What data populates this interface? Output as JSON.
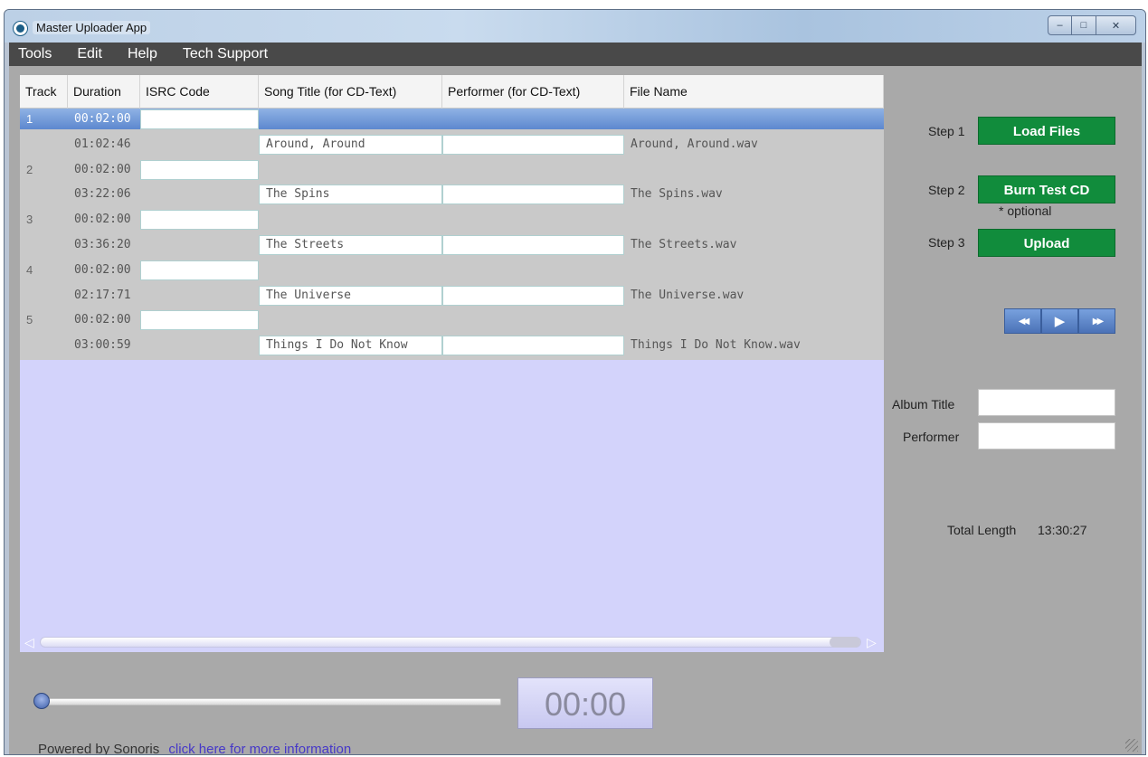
{
  "window": {
    "title": "Master Uploader App",
    "controls": {
      "minimize": "–",
      "maximize": "□",
      "close": "✕"
    }
  },
  "menu": [
    "Tools",
    "Edit",
    "Help",
    "Tech Support"
  ],
  "table": {
    "columns": [
      "Track",
      "Duration",
      "ISRC Code",
      "Song Title (for CD-Text)",
      "Performer (for CD-Text)",
      "File Name"
    ],
    "rows": [
      {
        "track": "1",
        "duration": "00:02:00",
        "title": "",
        "file": "",
        "kind": "pregap",
        "selected": true
      },
      {
        "track": "",
        "duration": "01:02:46",
        "title": "Around, Around",
        "file": "Around, Around.wav",
        "kind": "song"
      },
      {
        "track": "2",
        "duration": "00:02:00",
        "title": "",
        "file": "",
        "kind": "pregap"
      },
      {
        "track": "",
        "duration": "03:22:06",
        "title": "The Spins",
        "file": "The Spins.wav",
        "kind": "song"
      },
      {
        "track": "3",
        "duration": "00:02:00",
        "title": "",
        "file": "",
        "kind": "pregap"
      },
      {
        "track": "",
        "duration": "03:36:20",
        "title": "The Streets",
        "file": "The Streets.wav",
        "kind": "song"
      },
      {
        "track": "4",
        "duration": "00:02:00",
        "title": "",
        "file": "",
        "kind": "pregap"
      },
      {
        "track": "",
        "duration": "02:17:71",
        "title": "The Universe",
        "file": "The Universe.wav",
        "kind": "song"
      },
      {
        "track": "5",
        "duration": "00:02:00",
        "title": "",
        "file": "",
        "kind": "pregap"
      },
      {
        "track": "",
        "duration": "03:00:59",
        "title": "Things I Do Not Know",
        "file": "Things I Do Not Know.wav",
        "kind": "song"
      }
    ]
  },
  "steps": {
    "step1_label": "Step 1",
    "step1_button": "Load Files",
    "step2_label": "Step 2",
    "step2_button": "Burn Test CD",
    "step2_note": "* optional",
    "step3_label": "Step 3",
    "step3_button": "Upload"
  },
  "transport": {
    "rewind": "◀◀",
    "play": "▶",
    "fast_forward": "▶▶"
  },
  "album": {
    "album_title_label": "Album Title",
    "album_title_value": "",
    "performer_label": "Performer",
    "performer_value": "",
    "total_length_label": "Total Length",
    "total_length_value": "13:30:27"
  },
  "player": {
    "time": "00:00",
    "position": 0
  },
  "footer": {
    "powered_by": "Powered by Sonoris",
    "link_text": "click here for more information"
  },
  "colors": {
    "menubar": "#494949",
    "client": "#a9a9a9",
    "grid_bg": "#d3d3fb",
    "accent_green": "#118c3c",
    "selection": "#6a92d6",
    "link": "#4638c8"
  }
}
